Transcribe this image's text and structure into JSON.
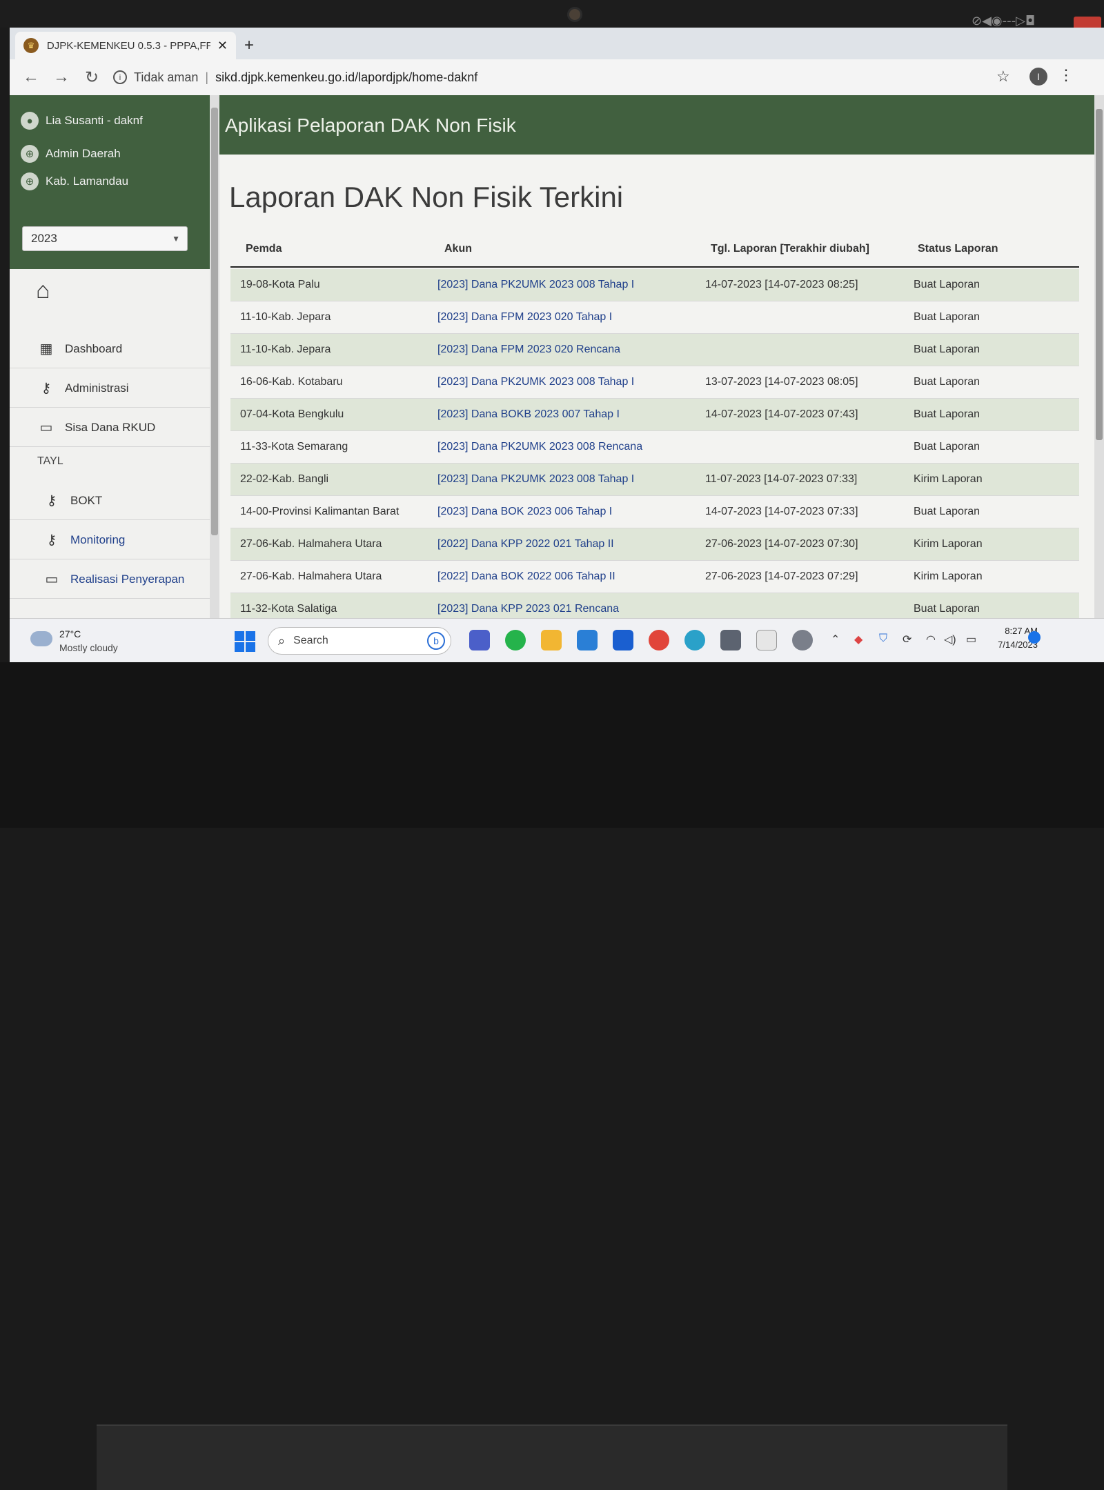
{
  "browser": {
    "tab_title": "DJPK-KEMENKEU 0.5.3 - PPPA,FP",
    "security_label": "Tidak aman",
    "url": "sikd.djpk.kemenkeu.go.id/lapordjpk/home-daknf"
  },
  "sidebar": {
    "user": "Lia Susanti - daknf",
    "role": "Admin Daerah",
    "region": "Kab. Lamandau",
    "year": "2023",
    "menu": [
      {
        "label": "Dashboard",
        "icon": "dashboard-icon"
      },
      {
        "label": "Administrasi",
        "icon": "key-icon"
      },
      {
        "label": "Sisa Dana RKUD",
        "icon": "card-icon"
      }
    ],
    "section": "TAYL",
    "submenu": [
      {
        "label": "BOKT",
        "icon": "key-icon"
      },
      {
        "label": "Monitoring",
        "icon": "key-icon"
      },
      {
        "label": "Realisasi Penyerapan",
        "icon": "card-icon"
      }
    ]
  },
  "main": {
    "app_title": "Aplikasi Pelaporan DAK Non Fisik",
    "page_title": "Laporan DAK Non Fisik Terkini",
    "columns": [
      "Pemda",
      "Akun",
      "Tgl. Laporan [Terakhir diubah]",
      "Status Laporan"
    ],
    "rows": [
      {
        "pemda": "19-08-Kota Palu",
        "akun": "[2023] Dana PK2UMK 2023 008 Tahap I",
        "tgl": "14-07-2023 [14-07-2023 08:25]",
        "status": "Buat Laporan"
      },
      {
        "pemda": "11-10-Kab. Jepara",
        "akun": "[2023] Dana FPM 2023 020 Tahap I",
        "tgl": "",
        "status": "Buat Laporan"
      },
      {
        "pemda": "11-10-Kab. Jepara",
        "akun": "[2023] Dana FPM 2023 020 Rencana",
        "tgl": "",
        "status": "Buat Laporan"
      },
      {
        "pemda": "16-06-Kab. Kotabaru",
        "akun": "[2023] Dana PK2UMK 2023 008 Tahap I",
        "tgl": "13-07-2023 [14-07-2023 08:05]",
        "status": "Buat Laporan"
      },
      {
        "pemda": "07-04-Kota Bengkulu",
        "akun": "[2023] Dana BOKB 2023 007 Tahap I",
        "tgl": "14-07-2023 [14-07-2023 07:43]",
        "status": "Buat Laporan"
      },
      {
        "pemda": "11-33-Kota Semarang",
        "akun": "[2023] Dana PK2UMK 2023 008 Rencana",
        "tgl": "",
        "status": "Buat Laporan"
      },
      {
        "pemda": "22-02-Kab. Bangli",
        "akun": "[2023] Dana PK2UMK 2023 008 Tahap I",
        "tgl": "11-07-2023 [14-07-2023 07:33]",
        "status": "Kirim Laporan"
      },
      {
        "pemda": "14-00-Provinsi Kalimantan Barat",
        "akun": "[2023] Dana BOK 2023 006 Tahap I",
        "tgl": "14-07-2023 [14-07-2023 07:33]",
        "status": "Buat Laporan"
      },
      {
        "pemda": "27-06-Kab. Halmahera Utara",
        "akun": "[2022] Dana KPP 2022 021 Tahap II",
        "tgl": "27-06-2023 [14-07-2023 07:30]",
        "status": "Kirim Laporan"
      },
      {
        "pemda": "27-06-Kab. Halmahera Utara",
        "akun": "[2022] Dana BOK 2022 006 Tahap II",
        "tgl": "27-06-2023 [14-07-2023 07:29]",
        "status": "Kirim Laporan"
      },
      {
        "pemda": "11-32-Kota Salatiga",
        "akun": "[2023] Dana KPP 2023 021 Rencana",
        "tgl": "",
        "status": "Buat Laporan"
      }
    ]
  },
  "taskbar": {
    "temperature": "27°C",
    "weather": "Mostly cloudy",
    "search_label": "Search",
    "time": "8:27 AM",
    "date": "7/14/2023"
  },
  "colors": {
    "header_green": "#41603f",
    "row_alt": "#dfe6d8",
    "link_blue": "#1f3f8a"
  }
}
